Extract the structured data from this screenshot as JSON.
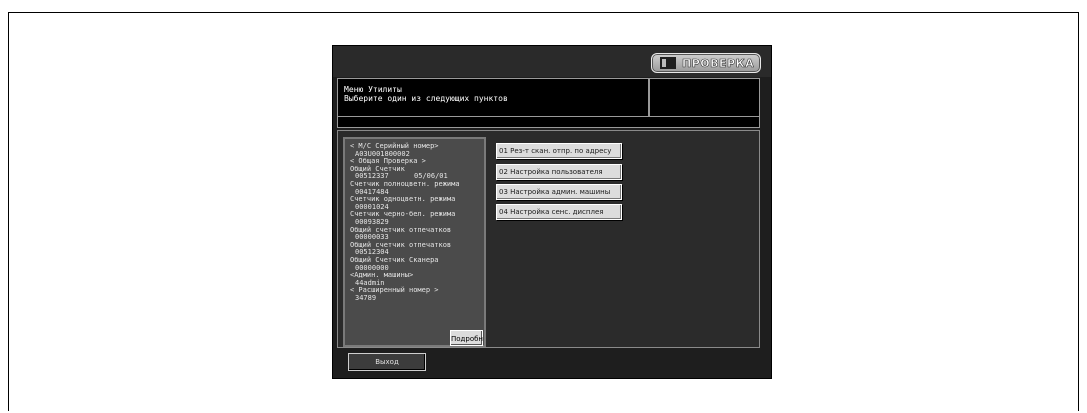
{
  "header": {
    "check_label": "ПРОВЕРКА"
  },
  "message": {
    "line1": "Меню Утилиты",
    "line2": "Выберите один из следующих пунктов"
  },
  "info": {
    "serial_label": "< М/С Серийный номер>",
    "serial_value": "A03U001800002",
    "general_check": "< Общая Проверка >",
    "total_counter_label": "Общий Счетчик",
    "total_counter_value": "00512337",
    "total_counter_date": "05/06/01",
    "color_mode_label": "Счетчик полноцветн. режима",
    "color_mode_value": "00417484",
    "single_color_label": "Счетчик одноцветн. режима",
    "single_color_value": "00001024",
    "bw_mode_label": "Счетчик черно-бел. режима",
    "bw_mode_value": "00093829",
    "prints1_label": "Общий счетчик отпечатков",
    "prints1_value": "00000033",
    "prints2_label": "Общий счетчик отпечатков",
    "prints2_value": "00512304",
    "scanner_label": "Общий Счетчик Сканера",
    "scanner_value": "00000000",
    "admin_label": "<Админ. машины>",
    "admin_value": "44admin",
    "ext_number_label": "< Расширенный номер >",
    "ext_number_value": "34789",
    "details_button": "Подробн"
  },
  "menu": [
    {
      "label": "01 Рез-т скан. отпр. по адресу"
    },
    {
      "label": "02 Настройка пользователя"
    },
    {
      "label": "03 Настройка админ. машины"
    },
    {
      "label": "04 Настройка сенс. дисплея"
    }
  ],
  "footer": {
    "exit_button": "Выход"
  }
}
